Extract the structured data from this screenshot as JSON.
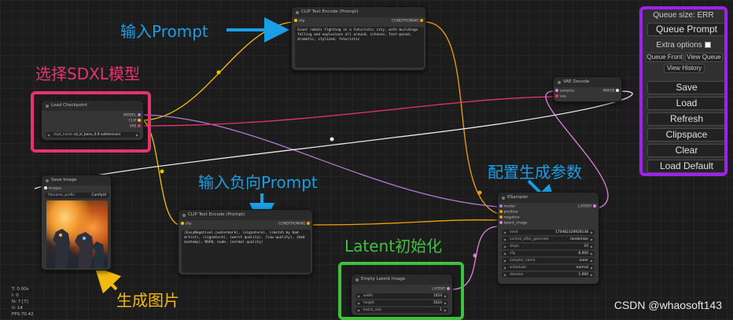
{
  "annotations": {
    "input_prompt": "输入Prompt",
    "select_model": "选择SDXL模型",
    "negative_prompt": "输入负向Prompt",
    "config_params": "配置生成参数",
    "latent_init": "Latent初始化",
    "gen_image": "生成图片"
  },
  "nodes": {
    "clip_pos": {
      "title": "CLIP Text Encode (Prompt)",
      "in_clip": "clip",
      "out": "CONDITIONING",
      "text": "Giant robots fighting in a futuristic city, with buildings falling and explosions all around, intense, fast-paced, dramatic, stylized, futuristic"
    },
    "checkpoint": {
      "title": "Load Checkpoint",
      "out_model": "MODEL",
      "out_clip": "CLIP",
      "out_vae": "VAE",
      "ckpt_label": "ckpt_name",
      "ckpt_value": "sd_xl_base_0.9.safetensors"
    },
    "vae_decode": {
      "title": "VAE Decode",
      "in_samples": "samples",
      "in_vae": "vae",
      "out": "IMAGE"
    },
    "save_image": {
      "title": "Save Image",
      "in_images": "images",
      "prefix_label": "filename_prefix",
      "prefix_value": "ComfyUI"
    },
    "clip_neg": {
      "title": "CLIP Text Encode (Prompt)",
      "in_clip": "clip",
      "out": "CONDITIONING",
      "text": "(EasyNegative),(watermark), (signature), (sketch by bad-artist), (signature), (worst quality), (low quality), (bad anatomy), NSFW, nude, (normal quality)"
    },
    "ksampler": {
      "title": "KSampler",
      "in_model": "model",
      "in_positive": "positive",
      "in_negative": "negative",
      "in_latent": "latent_image",
      "out": "LATENT",
      "widgets": [
        {
          "label": "seed",
          "value": "170482328928138"
        },
        {
          "label": "control_after_generate",
          "value": "randomize"
        },
        {
          "label": "steps",
          "value": "20"
        },
        {
          "label": "cfg",
          "value": "8.000"
        },
        {
          "label": "sampler_name",
          "value": "euler"
        },
        {
          "label": "scheduler",
          "value": "normal"
        },
        {
          "label": "denoise",
          "value": "1.000"
        }
      ]
    },
    "empty_latent": {
      "title": "Empty Latent Image",
      "out": "LATENT",
      "widgets": [
        {
          "label": "width",
          "value": "1024"
        },
        {
          "label": "height",
          "value": "1024"
        },
        {
          "label": "batch_size",
          "value": "1"
        }
      ]
    }
  },
  "menu": {
    "queue_size": "Queue size: ERR",
    "queue_prompt": "Queue Prompt",
    "extra_options": "Extra options",
    "queue_front": "Queue Front",
    "view_queue": "View Queue",
    "view_history": "View History",
    "save": "Save",
    "load": "Load",
    "refresh": "Refresh",
    "clipspace": "Clipspace",
    "clear": "Clear",
    "load_default": "Load Default"
  },
  "stats": {
    "t": "T: 0.00s",
    "i": "I: 0",
    "n": "N: 7 [7]",
    "v": "V: 14",
    "fps": "FPS:70.42"
  },
  "watermark": "CSDN @whaosoft143",
  "colors": {
    "highlight_pink": "#e6336e",
    "highlight_green": "#3ec23e",
    "highlight_purple": "#a020f0",
    "annotation_blue": "#1a9ee6",
    "annotation_yellow": "#f2b90f",
    "wire_clip": "#f2c200",
    "wire_model": "#b07ad9",
    "wire_vae": "#e8346e",
    "wire_latent": "#e080e0",
    "wire_image": "#e8e8e8"
  }
}
